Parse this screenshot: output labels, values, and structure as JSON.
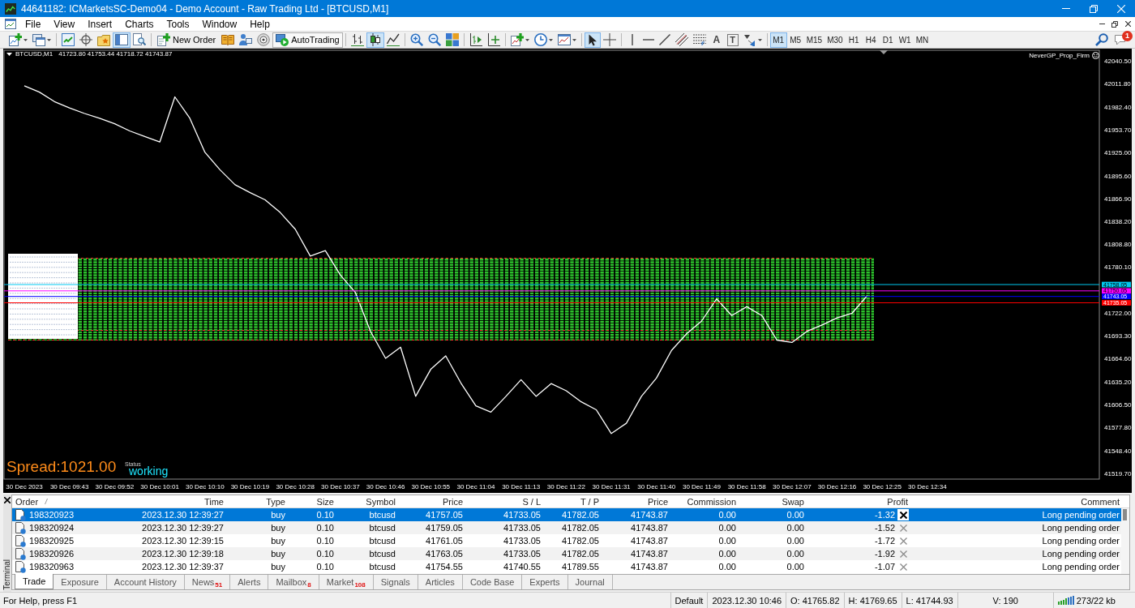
{
  "window": {
    "title": "44641182: ICMarketsSC-Demo04 - Demo Account - Raw Trading Ltd - [BTCUSD,M1]"
  },
  "menu": [
    "File",
    "View",
    "Insert",
    "Charts",
    "Tools",
    "Window",
    "Help"
  ],
  "toolbar": {
    "view_buttons": [
      {
        "selected": false
      },
      {
        "selected": false
      },
      {
        "selected": false
      },
      {
        "selected": true
      },
      {
        "selected": false
      }
    ],
    "new_order": "New Order",
    "autotrading": {
      "label": "AutoTrading",
      "on": true
    },
    "chart_types": [
      {
        "selected": false
      },
      {
        "selected": true
      },
      {
        "selected": false
      }
    ],
    "cursor_modes": [
      {
        "selected": true
      },
      {
        "selected": false
      }
    ],
    "text_tools": [
      "A",
      "T"
    ],
    "timeframes": [
      {
        "label": "M1",
        "selected": true
      },
      {
        "label": "M5",
        "selected": false
      },
      {
        "label": "M15",
        "selected": false
      },
      {
        "label": "M30",
        "selected": false
      },
      {
        "label": "H1",
        "selected": false
      },
      {
        "label": "H4",
        "selected": false
      },
      {
        "label": "D1",
        "selected": false
      },
      {
        "label": "W1",
        "selected": false
      },
      {
        "label": "MN",
        "selected": false
      }
    ],
    "notifications": "1"
  },
  "chart": {
    "ohlc": "41723.80 41753.44 41718.72 41743.87",
    "expert": "NeverGP_Prop_Firm",
    "spread": "Spread:1021.00",
    "status_label": "Status",
    "status": "working",
    "chart_data": {
      "type": "line",
      "categories": [
        "30 Dec 2023",
        null,
        null,
        "30 Dec 09:43",
        null,
        null,
        "30 Dec 09:52",
        null,
        null,
        "30 Dec 10:01",
        null,
        null,
        "30 Dec 10:10",
        null,
        null,
        "30 Dec 10:19",
        null,
        null,
        "30 Dec 10:28",
        null,
        null,
        "30 Dec 10:37",
        null,
        null,
        "30 Dec 10:46",
        null,
        null,
        "30 Dec 10:55",
        null,
        null,
        "30 Dec 11:04",
        null,
        null,
        "30 Dec 11:13",
        null,
        null,
        "30 Dec 11:22",
        null,
        null,
        "30 Dec 11:31",
        null,
        null,
        "30 Dec 11:40",
        null,
        null,
        "30 Dec 11:49",
        null,
        null,
        "30 Dec 11:58",
        null,
        null,
        "30 Dec 12:07",
        null,
        null,
        "30 Dec 12:16",
        null,
        null,
        "30 Dec 12:25",
        null,
        null,
        "30 Dec 12:34"
      ],
      "series": [
        {
          "name": "BTCUSD,M1",
          "color": "#ffffff",
          "values": [
            42009,
            42001,
            41989,
            41981,
            41974,
            41968,
            41961,
            41952,
            41945,
            41938,
            41995,
            41968,
            41925,
            41903,
            41884,
            41874,
            41865,
            41849,
            41828,
            41794,
            41801,
            41770,
            41748,
            41699,
            41665,
            41679,
            41617,
            41651,
            41668,
            41634,
            41605,
            41597,
            41617,
            41638,
            41617,
            41633,
            41624,
            41610,
            41600,
            41570,
            41583,
            41617,
            41640,
            41675,
            41696,
            41712,
            41740,
            41719,
            41730,
            41719,
            41688,
            41685,
            41699,
            41707,
            41716,
            41722,
            41744,
            null,
            null,
            null,
            null
          ]
        }
      ],
      "ylim": [
        41512.5,
        42053.8
      ],
      "yticks": [
        {
          "value": 42040.5,
          "label": "42040.50"
        },
        {
          "value": 42011.8,
          "label": "42011.80"
        },
        {
          "value": 41982.4,
          "label": "41982.40"
        },
        {
          "value": 41953.7,
          "label": "41953.70"
        },
        {
          "value": 41925.0,
          "label": "41925.00"
        },
        {
          "value": 41895.6,
          "label": "41895.60"
        },
        {
          "value": 41866.9,
          "label": "41866.90"
        },
        {
          "value": 41838.2,
          "label": "41838.20"
        },
        {
          "value": 41808.8,
          "label": "41808.80"
        },
        {
          "value": 41780.1,
          "label": "41780.10"
        },
        {
          "value": 41722.0,
          "label": "41722.00"
        },
        {
          "value": 41693.3,
          "label": "41693.30"
        },
        {
          "value": 41664.6,
          "label": "41664.60"
        },
        {
          "value": 41635.2,
          "label": "41635.20"
        },
        {
          "value": 41606.5,
          "label": "41606.50"
        },
        {
          "value": 41577.8,
          "label": "41577.80"
        },
        {
          "value": 41548.4,
          "label": "41548.40"
        },
        {
          "value": 41519.7,
          "label": "41519.70"
        }
      ],
      "ref_lines": [
        {
          "axis": "y",
          "value": 41758.05,
          "label": "41758.05",
          "color": "#00c8f0"
        },
        {
          "axis": "y",
          "value": 41750.05,
          "label": "41750.05",
          "color": "#ff00ff"
        },
        {
          "axis": "y",
          "value": 41743.05,
          "label": "41743.05",
          "color": "#0000ff"
        },
        {
          "axis": "y",
          "value": 41735.05,
          "label": "41735.05",
          "color": "#ff0000"
        }
      ]
    }
  },
  "terminal": {
    "title": "Terminal",
    "columns": [
      "Order",
      "Time",
      "Type",
      "Size",
      "Symbol",
      "Price",
      "S / L",
      "T / P",
      "Price",
      "Commission",
      "Swap",
      "Profit",
      "Comment"
    ],
    "rows": [
      {
        "selected": true,
        "cells": [
          "198320923",
          "2023.12.30 12:39:27",
          "buy",
          "0.10",
          "btcusd",
          "41757.05",
          "41733.05",
          "41782.05",
          "41743.87",
          "0.00",
          "0.00",
          "-1.32",
          "Long pending order"
        ]
      },
      {
        "selected": false,
        "cells": [
          "198320924",
          "2023.12.30 12:39:27",
          "buy",
          "0.10",
          "btcusd",
          "41759.05",
          "41733.05",
          "41782.05",
          "41743.87",
          "0.00",
          "0.00",
          "-1.52",
          "Long pending order"
        ]
      },
      {
        "selected": false,
        "cells": [
          "198320925",
          "2023.12.30 12:39:15",
          "buy",
          "0.10",
          "btcusd",
          "41761.05",
          "41733.05",
          "41782.05",
          "41743.87",
          "0.00",
          "0.00",
          "-1.72",
          "Long pending order"
        ]
      },
      {
        "selected": false,
        "cells": [
          "198320926",
          "2023.12.30 12:39:18",
          "buy",
          "0.10",
          "btcusd",
          "41763.05",
          "41733.05",
          "41782.05",
          "41743.87",
          "0.00",
          "0.00",
          "-1.92",
          "Long pending order"
        ]
      },
      {
        "selected": false,
        "cells": [
          "198320963",
          "2023.12.30 12:39:37",
          "buy",
          "0.10",
          "btcusd",
          "41754.55",
          "41740.55",
          "41789.55",
          "41743.87",
          "0.00",
          "0.00",
          "-1.07",
          "Long pending order"
        ]
      }
    ],
    "tabs": [
      {
        "label": "Trade",
        "selected": true
      },
      {
        "label": "Exposure",
        "selected": false
      },
      {
        "label": "Account History",
        "selected": false
      },
      {
        "label": "News",
        "count": "51",
        "selected": false
      },
      {
        "label": "Alerts",
        "selected": false
      },
      {
        "label": "Mailbox",
        "count": "8",
        "selected": false
      },
      {
        "label": "Market",
        "count": "108",
        "selected": false
      },
      {
        "label": "Signals",
        "selected": false
      },
      {
        "label": "Articles",
        "selected": false
      },
      {
        "label": "Code Base",
        "selected": false
      },
      {
        "label": "Experts",
        "selected": false
      },
      {
        "label": "Journal",
        "selected": false
      }
    ]
  },
  "status_bar": {
    "help": "For Help, press F1",
    "segments": [
      {
        "kind": "text",
        "text": "Default"
      },
      {
        "kind": "text",
        "text": "2023.12.30 10:46"
      },
      {
        "kind": "text",
        "text": "O: 41765.82"
      },
      {
        "kind": "text",
        "text": "H: 41769.65"
      },
      {
        "kind": "text",
        "text": "L: 41744.93"
      },
      {
        "kind": "wide",
        "text": "V: 190"
      },
      {
        "kind": "traffic",
        "text": "273/22 kb"
      }
    ]
  }
}
